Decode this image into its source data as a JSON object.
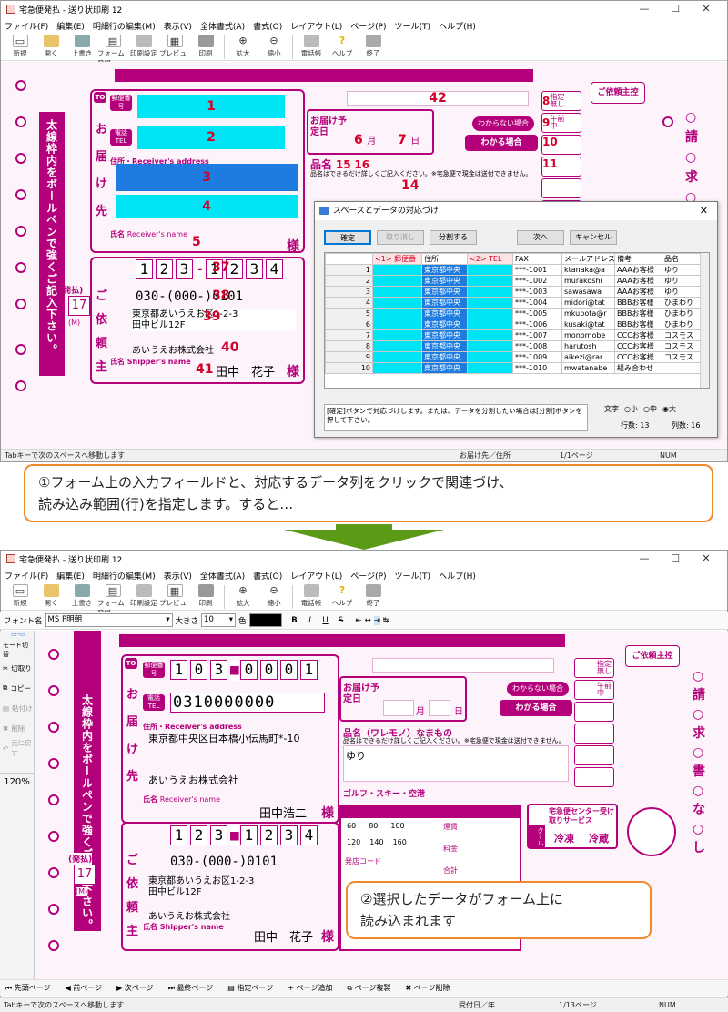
{
  "app": {
    "title": "宅急便発払 - 送り状印刷 12",
    "minimize": "—",
    "maximize": "☐",
    "close": "✕"
  },
  "menu": [
    "ファイル(F)",
    "編集(E)",
    "明細行の編集(M)",
    "表示(V)",
    "全体書式(A)",
    "書式(O)",
    "レイアウト(L)",
    "ページ(P)",
    "ツール(T)",
    "ヘルプ(H)"
  ],
  "toolbar": [
    "新規",
    "開く",
    "上書き",
    "フォーム登録",
    "印刷設定",
    "プレビュー",
    "印刷",
    "拡大",
    "縮小",
    "電話帳",
    "ヘルプ",
    "終了"
  ],
  "form": {
    "to_label": "TO",
    "postcode_label": "郵便番号",
    "tel_label": "電話TEL",
    "address_label": "住所・Receiver's address",
    "name_label": "氏名",
    "name_label_en": "Receiver's name",
    "sama": "様",
    "otodoke": [
      "お",
      "届",
      "け",
      "先"
    ],
    "irai": [
      "ご",
      "依",
      "頼",
      "主"
    ],
    "strip_text": "太線枠内をボールペンで強くご記入下さい。",
    "hatsu": "(発払)",
    "number_17": "17",
    "m_label": "(M)",
    "goirai_btn": "ご依頼主控",
    "seikyu": [
      "請",
      "求"
    ],
    "seikyu2": [
      "請",
      "求",
      "書",
      "な",
      "し"
    ],
    "otodoke_date": "お届け予定日",
    "kibou_tsuki": "月",
    "kibou_hi": "日",
    "hinmei": "品名",
    "hinmei_note": "品名はできるだけ詳しくご記入ください。※宅急便で現金は送付できません。",
    "wakaranai": "わからない場合",
    "wakaru": "わかる場合",
    "shitei_nashi": "指定無し",
    "gozenchu": "午前中",
    "shipper_name": "田中　花子",
    "shipper_name_label": "氏名 Shipper's name",
    "shipper_company": "あいうえお株式会社",
    "shipper_addr1": "東京都あいうえお区1-2-3",
    "shipper_addr2": "田中ビル12F",
    "shipper_post": [
      "1",
      "2",
      "3",
      "1",
      "2",
      "3",
      "4"
    ],
    "shipper_tel": "030-(000-)0101"
  },
  "top_form_nums": {
    "n1": "1",
    "n2": "2",
    "n3": "3",
    "n4": "4",
    "n5": "5",
    "n6": "6",
    "n7": "7",
    "n8": "8",
    "n9": "9",
    "n10": "10",
    "n11": "11",
    "n14": "14",
    "n15": "15",
    "n16": "16",
    "n37": "37",
    "n38": "38",
    "n39": "39",
    "n40": "40",
    "n41": "41",
    "n42": "42"
  },
  "dialog": {
    "title": "スペースとデータの対応づけ",
    "btn_kakutei": "確定",
    "btn_torikeshi": "取り消し",
    "btn_bunkatsu": "分割する",
    "btn_next": "次へ",
    "btn_cancel": "キャンセル",
    "columns": [
      "<1> 郵便番",
      "住所",
      "<2> TEL",
      "FAX",
      "メールアドレス",
      "備考",
      "品名"
    ],
    "rows": [
      {
        "n": "1",
        "addr": "東京都中央",
        "fax": "***-1001",
        "mail": "ktanaka@a",
        "note": "AAAお客様",
        "item": "ゆり"
      },
      {
        "n": "2",
        "addr": "東京都中央",
        "fax": "***-1002",
        "mail": "murakoshi",
        "note": "AAAお客様",
        "item": "ゆり"
      },
      {
        "n": "3",
        "addr": "東京都中央",
        "fax": "***-1003",
        "mail": "sawasawa",
        "note": "AAAお客様",
        "item": "ゆり"
      },
      {
        "n": "4",
        "addr": "東京都中央",
        "fax": "***-1004",
        "mail": "midori@tat",
        "note": "BBBお客様",
        "item": "ひまわり"
      },
      {
        "n": "5",
        "addr": "東京都中央",
        "fax": "***-1005",
        "mail": "mkubota@r",
        "note": "BBBお客様",
        "item": "ひまわり"
      },
      {
        "n": "6",
        "addr": "東京都中央",
        "fax": "***-1006",
        "mail": "kusaki@tat",
        "note": "BBBお客様",
        "item": "ひまわり"
      },
      {
        "n": "7",
        "addr": "東京都中央",
        "fax": "***-1007",
        "mail": "monomobe",
        "note": "CCCお客様",
        "item": "コスモス"
      },
      {
        "n": "8",
        "addr": "東京都中央",
        "fax": "***-1008",
        "mail": "harutosh",
        "note": "CCCお客様",
        "item": "コスモス"
      },
      {
        "n": "9",
        "addr": "東京都中央",
        "fax": "***-1009",
        "mail": "aikezi@rar",
        "note": "CCCお客様",
        "item": "コスモス"
      },
      {
        "n": "10",
        "addr": "東京都中央",
        "fax": "***-1010",
        "mail": "mwatanabe",
        "note": "組み合わせ",
        "item": ""
      }
    ],
    "hint": "[確定]ボタンで対応づけします。または、データを分割したい場合は[分割]ボタンを押して下さい。",
    "moji": "文字",
    "size_small": "小",
    "size_mid": "中",
    "size_large": "大",
    "rows_count": "行数: 13",
    "cols_count": "列数: 16"
  },
  "status_top": {
    "left": "Tabキーで次のスペースへ移動します",
    "field": "お届け先／住所",
    "page": "1/1ページ",
    "num": "NUM"
  },
  "callout1": {
    "line1": "①フォーム上の入力フィールドと、対応するデータ列をクリックで関連づけ、",
    "line2": "読み込み範囲(行)を指定します。すると…"
  },
  "format_bar": {
    "font_label": "フォント名",
    "font": "MS P明朝",
    "size_label": "大きさ",
    "size": "10",
    "color_label": "色",
    "bold": "B",
    "italic": "I",
    "underline": "U",
    "strike": "S"
  },
  "side_panel": [
    "モード切替",
    "切取り",
    "コピー",
    "貼付け",
    "削除",
    "元に戻す"
  ],
  "zoom": "120%",
  "bottom_form": {
    "postcode": [
      "1",
      "0",
      "3",
      "0",
      "0",
      "0",
      "1"
    ],
    "tel": "0310000000",
    "addr": "東京都中央区日本橋小伝馬町*-10",
    "company": "あいうえお株式会社",
    "name": "田中浩二",
    "hinmei_sub": "品名（ワレモノ）なまもの",
    "item": "ゆり",
    "golf": "ゴルフ・スキー・空港",
    "hatsusou_code": "発店コード",
    "cool": "クール",
    "reito": "冷凍",
    "reizou": "冷蔵",
    "uketori": "宅急便センター受け取りサービス",
    "hatsusou_sizes": [
      "60",
      "80",
      "100"
    ],
    "hatsusou_sizes2": [
      "120",
      "140",
      "160"
    ],
    "unchin": "運賃",
    "ryokin": "料金",
    "goukei": "合計"
  },
  "callout2": {
    "line1": "②選択したデータがフォーム上に",
    "line2": "読み込まれます"
  },
  "navbar": [
    "先頭ページ",
    "前ページ",
    "次ページ",
    "最終ページ",
    "指定ページ",
    "ページ追加",
    "ページ複製",
    "ページ削除"
  ],
  "status_bottom": {
    "left": "Tabキーで次のスペースへ移動します",
    "field": "受付日／年",
    "page": "1/13ページ",
    "num": "NUM"
  },
  "colors": {
    "magenta": "#b4007a",
    "cyan": "#00e5f5",
    "blue": "#1e7be0",
    "arrow": "#5b9a16",
    "orange": "#f08a2a"
  }
}
